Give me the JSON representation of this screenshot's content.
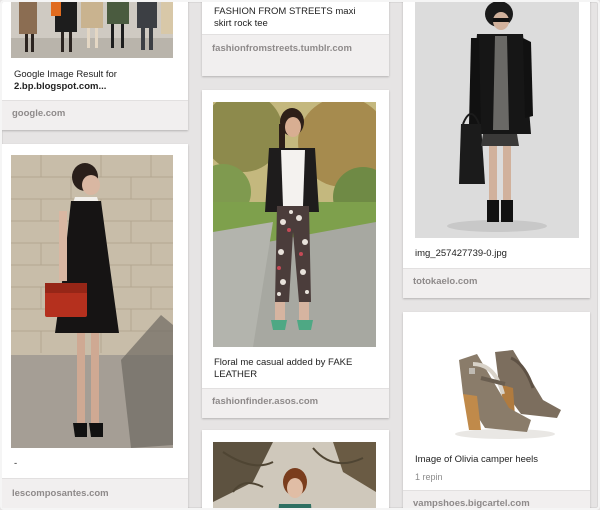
{
  "pins": {
    "col1_top": {
      "desc_line1": "Google Image Result for",
      "desc_line2": "2.bp.blogspot.com...",
      "source": "google.com"
    },
    "col1_mid": {
      "desc": "-",
      "source": "lescomposantes.com"
    },
    "col2_top": {
      "desc": "FASHION FROM STREETS maxi skirt rock tee",
      "source": "fashionfromstreets.tumblr.com"
    },
    "col2_mid": {
      "desc": "Floral me casual added by FAKE LEATHER",
      "source": "fashionfinder.asos.com"
    },
    "col3_top": {
      "desc": "img_257427739-0.jpg",
      "source": "totokaelo.com"
    },
    "col3_mid": {
      "desc": "Image of Olivia camper heels",
      "repins": "1 repin",
      "source": "vampshoes.bigcartel.com"
    }
  },
  "colors": {
    "background": "#e6e4e4",
    "card": "#ffffff",
    "source_bar": "#f1efef",
    "source_text": "#8e8a8a"
  }
}
